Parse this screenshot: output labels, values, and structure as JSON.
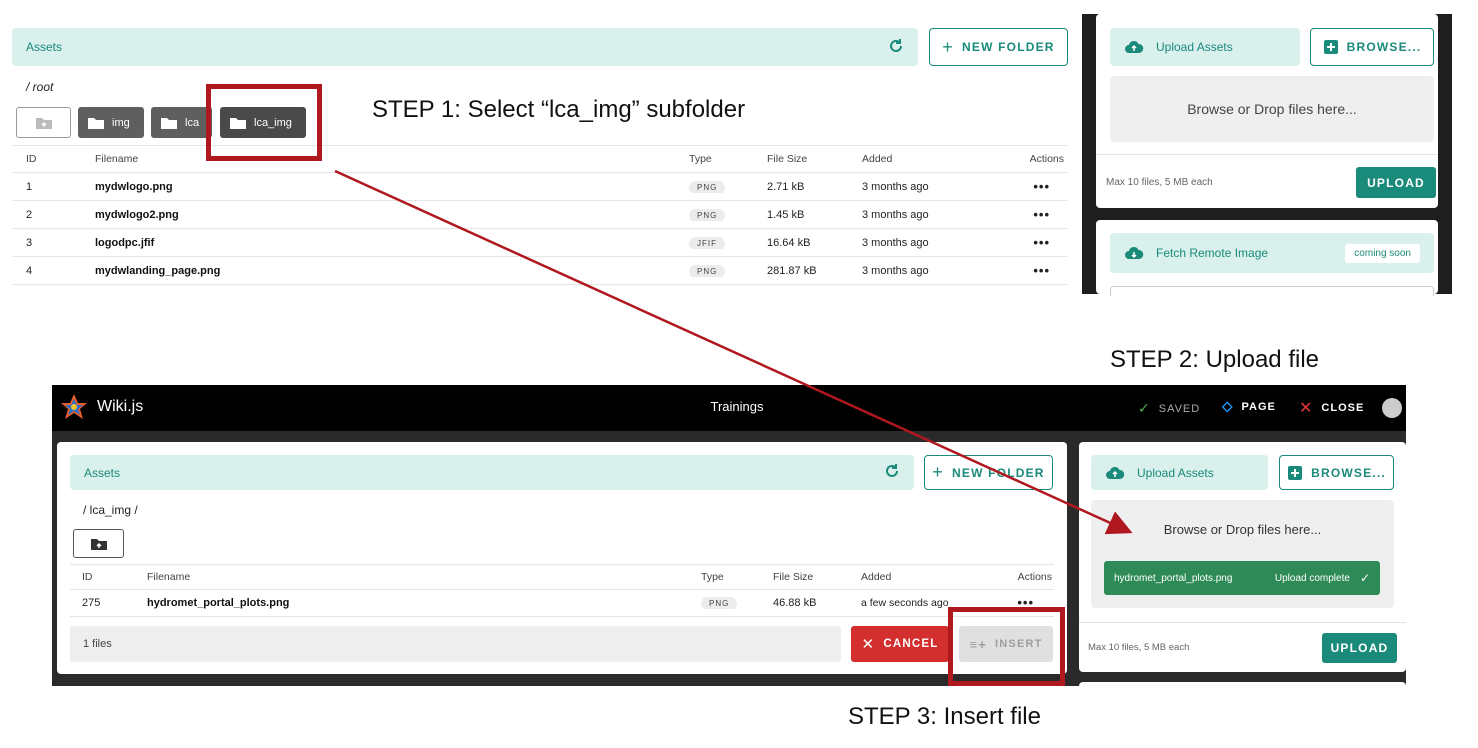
{
  "steps": {
    "step1": "STEP 1: Select “lca_img” subfolder",
    "step2": "STEP 2: Upload file",
    "step3": "STEP 3: Insert file"
  },
  "top": {
    "assets_label": "Assets",
    "new_folder": "NEW FOLDER",
    "path": "/ root",
    "folders": [
      "img",
      "lca",
      "lca_img"
    ],
    "columns": [
      "ID",
      "Filename",
      "Type",
      "File Size",
      "Added",
      "Actions"
    ],
    "rows": [
      {
        "id": "1",
        "name": "mydwlogo.png",
        "type": "PNG",
        "size": "2.71 kB",
        "added": "3 months ago"
      },
      {
        "id": "2",
        "name": "mydwlogo2.png",
        "type": "PNG",
        "size": "1.45 kB",
        "added": "3 months ago"
      },
      {
        "id": "3",
        "name": "logodpc.jfif",
        "type": "JFIF",
        "size": "16.64 kB",
        "added": "3 months ago"
      },
      {
        "id": "4",
        "name": "mydwlanding_page.png",
        "type": "PNG",
        "size": "281.87 kB",
        "added": "3 months ago"
      }
    ],
    "upload": {
      "upload_assets": "Upload Assets",
      "browse": "BROWSE...",
      "drop": "Browse or Drop files here...",
      "max": "Max 10 files, 5 MB each",
      "upload_btn": "UPLOAD",
      "fetch": "Fetch Remote Image",
      "coming_soon": "coming soon"
    }
  },
  "bottom": {
    "app_name": "Wiki.js",
    "page_title": "Trainings",
    "saved": "SAVED",
    "page": "PAGE",
    "close": "CLOSE",
    "assets_label": "Assets",
    "new_folder": "NEW FOLDER",
    "path": "/ lca_img /",
    "columns": [
      "ID",
      "Filename",
      "Type",
      "File Size",
      "Added",
      "Actions"
    ],
    "rows": [
      {
        "id": "275",
        "name": "hydromet_portal_plots.png",
        "type": "PNG",
        "size": "46.88 kB",
        "added": "a few seconds ago"
      }
    ],
    "file_count": "1 files",
    "cancel": "CANCEL",
    "insert": "INSERT",
    "upload": {
      "upload_assets": "Upload Assets",
      "browse": "BROWSE...",
      "drop": "Browse or Drop files here...",
      "uploaded_file": "hydromet_portal_plots.png",
      "upload_status": "Upload complete",
      "max": "Max 10 files, 5 MB each",
      "upload_btn": "UPLOAD"
    }
  },
  "colors": {
    "accent": "#1a8a7a",
    "accent_light": "#d9f0ec",
    "annotation_red": "#b01820",
    "cancel_red": "#d32f2f",
    "success_green": "#2e8b57"
  }
}
